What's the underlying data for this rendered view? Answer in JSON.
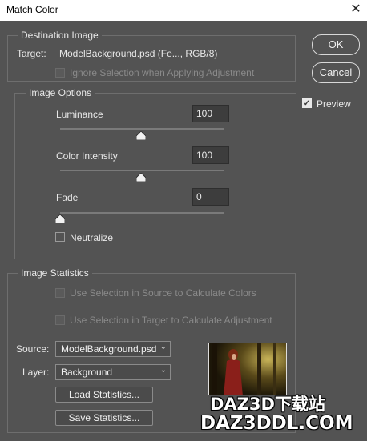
{
  "window": {
    "title": "Match Color",
    "close_glyph": "✕"
  },
  "destination": {
    "group_title": "Destination Image",
    "target_label": "Target:",
    "target_value": "ModelBackground.psd (Fe..., RGB/8)",
    "ignore_selection_label": "Ignore Selection when Applying Adjustment",
    "ignore_selection_checked": false,
    "ignore_selection_enabled": false
  },
  "image_options": {
    "group_title": "Image Options",
    "luminance": {
      "label": "Luminance",
      "value": "100",
      "level": 0.5
    },
    "color_intensity": {
      "label": "Color Intensity",
      "value": "100",
      "level": 0.5
    },
    "fade": {
      "label": "Fade",
      "value": "0",
      "level": 0.0
    },
    "neutralize_label": "Neutralize",
    "neutralize_checked": false
  },
  "statistics": {
    "group_title": "Image Statistics",
    "use_source_label": "Use Selection in Source to Calculate Colors",
    "use_target_label": "Use Selection in Target to Calculate Adjustment",
    "source_label": "Source:",
    "source_value": "ModelBackground.psd",
    "layer_label": "Layer:",
    "layer_value": "Background",
    "load_button": "Load Statistics...",
    "save_button": "Save Statistics..."
  },
  "buttons": {
    "ok": "OK",
    "cancel": "Cancel"
  },
  "preview": {
    "label": "Preview",
    "checked": true
  },
  "watermark": {
    "line1": "DAZ3D下载站",
    "line2": "DAZ3DDL.COM"
  },
  "icons": {
    "chevron": "chevron-down-icon",
    "check": "check-icon"
  },
  "colors": {
    "dialog_bg": "#535353",
    "field_bg": "#3d3d3d",
    "border": "#6e6e6e"
  }
}
